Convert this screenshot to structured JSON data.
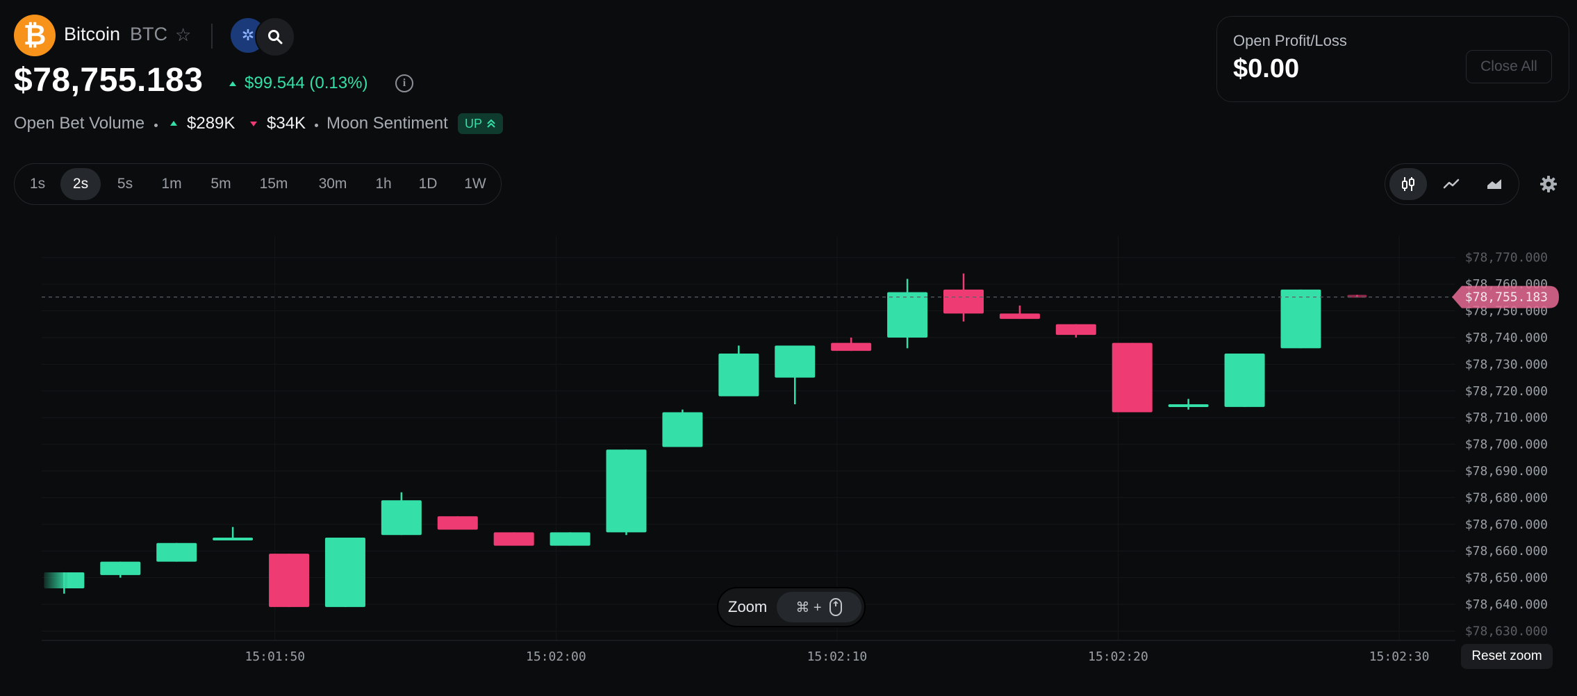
{
  "header": {
    "coin_name": "Bitcoin",
    "coin_symbol": "BTC",
    "price": "$78,755.183",
    "change": "$99.544 (0.13%)",
    "volume_label": "Open Bet Volume",
    "volume_up": "$289K",
    "volume_down": "$34K",
    "sentiment_label": "Moon Sentiment",
    "sentiment_badge": "UP"
  },
  "pnl": {
    "label": "Open Profit/Loss",
    "value": "$0.00",
    "close_all": "Close All"
  },
  "timeframes": [
    "1s",
    "2s",
    "5s",
    "1m",
    "5m",
    "15m",
    "30m",
    "1h",
    "1D",
    "1W"
  ],
  "active_timeframe": "2s",
  "chart_types": [
    "candlestick",
    "line",
    "area"
  ],
  "active_chart_type": "candlestick",
  "zoom": {
    "label": "Zoom",
    "keys": "⌘ +"
  },
  "reset_zoom": "Reset zoom",
  "colors": {
    "up": "#34e0a8",
    "down": "#ef3b73",
    "background": "#0b0c0e"
  },
  "chart_data": {
    "type": "candlestick",
    "y_tick_labels": [
      "$78,770.000",
      "$78,760.000",
      "$78,750.000",
      "$78,740.000",
      "$78,730.000",
      "$78,720.000",
      "$78,710.000",
      "$78,700.000",
      "$78,690.000",
      "$78,680.000",
      "$78,670.000",
      "$78,660.000",
      "$78,650.000",
      "$78,640.000",
      "$78,630.000"
    ],
    "y_ticks": [
      78770,
      78760,
      78750,
      78740,
      78730,
      78720,
      78710,
      78700,
      78690,
      78680,
      78670,
      78660,
      78650,
      78640,
      78630
    ],
    "ylim": [
      78627,
      78778
    ],
    "x_tick_labels": [
      "15:01:50",
      "15:02:00",
      "15:02:10",
      "15:02:20",
      "15:02:30"
    ],
    "x_ticks": [
      9.5,
      19.5,
      29.5,
      39.5,
      49.5
    ],
    "xlim": [
      1.2,
      51.5
    ],
    "current_price": 78755.183,
    "current_price_label": "$78,755.183",
    "candles": [
      {
        "x": 2,
        "o": 78646,
        "h": 78652,
        "l": 78644,
        "c": 78652
      },
      {
        "x": 4,
        "o": 78651,
        "h": 78656,
        "l": 78650,
        "c": 78656
      },
      {
        "x": 6,
        "o": 78656,
        "h": 78663,
        "l": 78656,
        "c": 78663
      },
      {
        "x": 8,
        "o": 78665,
        "h": 78669,
        "l": 78665,
        "c": 78665
      },
      {
        "x": 10,
        "o": 78659,
        "h": 78659,
        "l": 78639,
        "c": 78639
      },
      {
        "x": 12,
        "o": 78639,
        "h": 78665,
        "l": 78639,
        "c": 78665
      },
      {
        "x": 14,
        "o": 78666,
        "h": 78682,
        "l": 78666,
        "c": 78679
      },
      {
        "x": 16,
        "o": 78673,
        "h": 78673,
        "l": 78668,
        "c": 78668
      },
      {
        "x": 18,
        "o": 78667,
        "h": 78667,
        "l": 78662,
        "c": 78662
      },
      {
        "x": 20,
        "o": 78662,
        "h": 78667,
        "l": 78662,
        "c": 78667
      },
      {
        "x": 22,
        "o": 78667,
        "h": 78698,
        "l": 78666,
        "c": 78698
      },
      {
        "x": 24,
        "o": 78699,
        "h": 78713,
        "l": 78699,
        "c": 78712
      },
      {
        "x": 26,
        "o": 78718,
        "h": 78737,
        "l": 78718,
        "c": 78734
      },
      {
        "x": 28,
        "o": 78725,
        "h": 78737,
        "l": 78715,
        "c": 78737
      },
      {
        "x": 30,
        "o": 78738,
        "h": 78740,
        "l": 78735,
        "c": 78735
      },
      {
        "x": 32,
        "o": 78740,
        "h": 78762,
        "l": 78736,
        "c": 78757
      },
      {
        "x": 34,
        "o": 78758,
        "h": 78764,
        "l": 78746,
        "c": 78749
      },
      {
        "x": 36,
        "o": 78749,
        "h": 78752,
        "l": 78747,
        "c": 78747
      },
      {
        "x": 38,
        "o": 78745,
        "h": 78745,
        "l": 78740,
        "c": 78741
      },
      {
        "x": 40,
        "o": 78738,
        "h": 78738,
        "l": 78712,
        "c": 78712
      },
      {
        "x": 42,
        "o": 78715,
        "h": 78717,
        "l": 78713,
        "c": 78715
      },
      {
        "x": 44,
        "o": 78714,
        "h": 78734,
        "l": 78714,
        "c": 78734
      },
      {
        "x": 46,
        "o": 78736,
        "h": 78758,
        "l": 78736,
        "c": 78758
      },
      {
        "x": 48,
        "o": 78756,
        "h": 78756,
        "l": 78755,
        "c": 78755
      }
    ]
  }
}
